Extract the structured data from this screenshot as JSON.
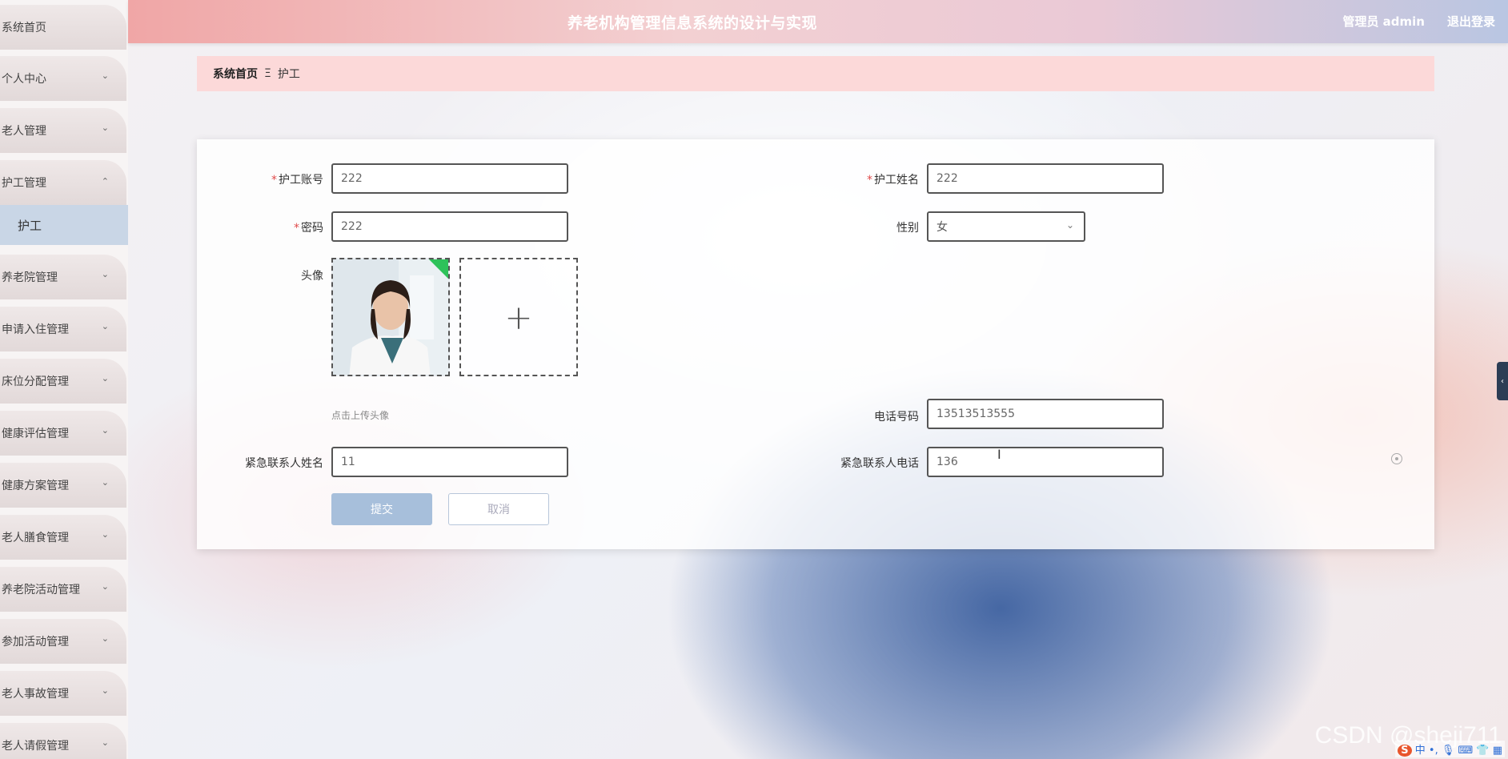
{
  "header": {
    "title": "养老机构管理信息系统的设计与实现",
    "user": "管理员 admin",
    "logout": "退出登录"
  },
  "sidebar": {
    "items": [
      {
        "label": "系统首页",
        "has_chevron": false
      },
      {
        "label": "个人中心",
        "has_chevron": true
      },
      {
        "label": "老人管理",
        "has_chevron": true
      },
      {
        "label": "护工管理",
        "has_chevron": true,
        "expanded": true
      },
      {
        "label": "养老院管理",
        "has_chevron": true
      },
      {
        "label": "申请入住管理",
        "has_chevron": true
      },
      {
        "label": "床位分配管理",
        "has_chevron": true
      },
      {
        "label": "健康评估管理",
        "has_chevron": true
      },
      {
        "label": "健康方案管理",
        "has_chevron": true
      },
      {
        "label": "老人膳食管理",
        "has_chevron": true
      },
      {
        "label": "养老院活动管理",
        "has_chevron": true
      },
      {
        "label": "参加活动管理",
        "has_chevron": true
      },
      {
        "label": "老人事故管理",
        "has_chevron": true
      },
      {
        "label": "老人请假管理",
        "has_chevron": true
      }
    ],
    "subitem": "护工"
  },
  "breadcrumb": {
    "home": "系统首页",
    "separator": "Ξ",
    "current": "护工"
  },
  "form": {
    "account": {
      "label": "护工账号",
      "value": "222",
      "required": true
    },
    "name": {
      "label": "护工姓名",
      "value": "222",
      "required": true
    },
    "password": {
      "label": "密码",
      "value": "222",
      "required": true
    },
    "gender": {
      "label": "性别",
      "value": "女"
    },
    "avatar": {
      "label": "头像",
      "hint": "点击上传头像"
    },
    "phone": {
      "label": "电话号码",
      "value": "13513513555"
    },
    "emergency_name": {
      "label": "紧急联系人姓名",
      "value": "11"
    },
    "emergency_phone": {
      "label": "紧急联系人电话",
      "value": "136"
    },
    "submit": "提交",
    "cancel": "取消"
  },
  "watermark": "CSDN @sheji711",
  "ime": "中"
}
